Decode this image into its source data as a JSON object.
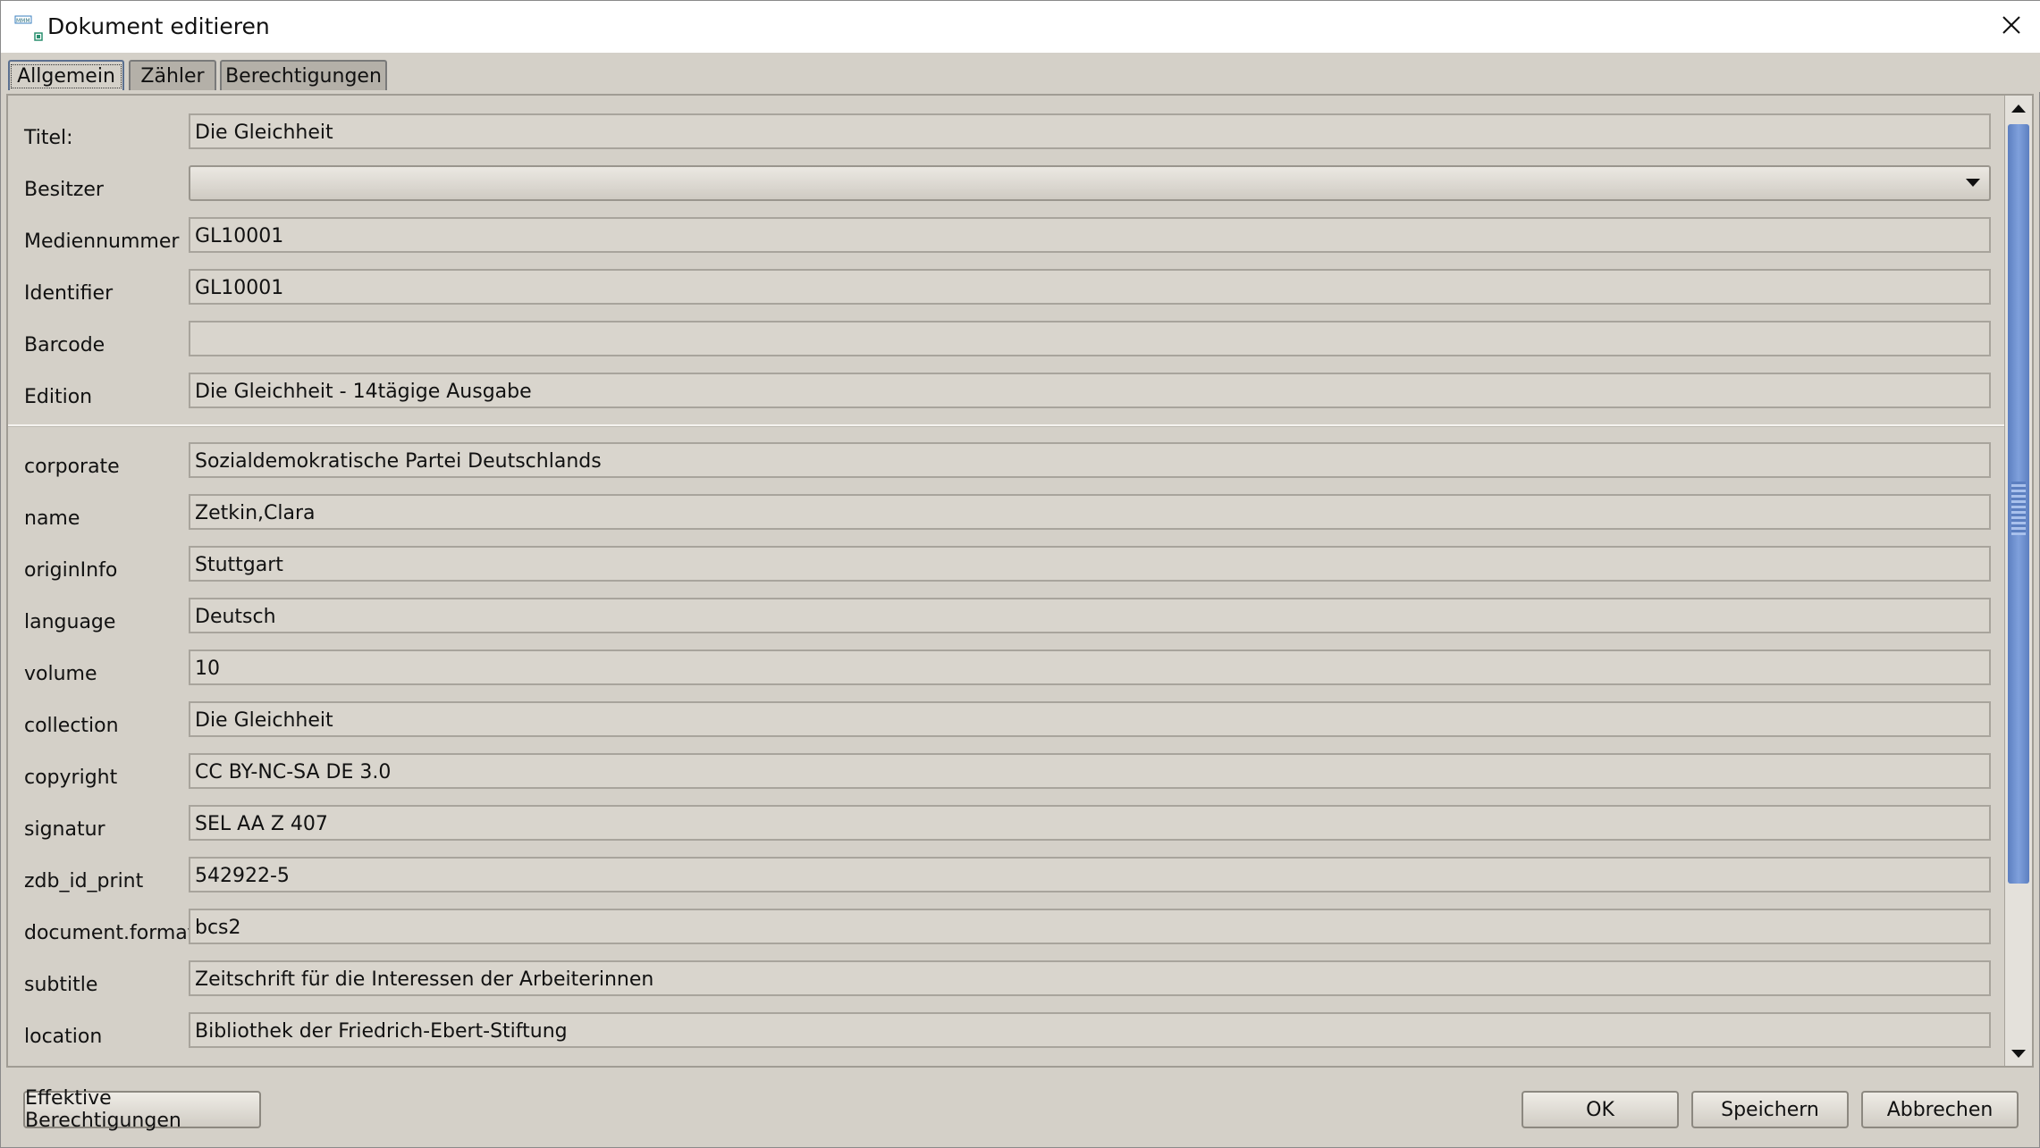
{
  "window": {
    "title": "Dokument editieren",
    "app_icon": "document-app-icon",
    "close_icon": "close-icon"
  },
  "tabs": [
    {
      "label": "Allgemein",
      "active": true
    },
    {
      "label": "Zähler",
      "active": false
    },
    {
      "label": "Berechtigungen",
      "active": false
    }
  ],
  "fields": [
    {
      "label": "Titel:",
      "value": "Die Gleichheit"
    },
    {
      "label": "Besitzer",
      "value": "",
      "type": "select"
    },
    {
      "label": "Mediennummer",
      "value": "GL10001"
    },
    {
      "label": "Identifier",
      "value": "GL10001"
    },
    {
      "label": "Barcode",
      "value": ""
    },
    {
      "label": "Edition",
      "value": "Die Gleichheit - 14tägige Ausgabe"
    }
  ],
  "metadata": [
    {
      "label": "corporate",
      "value": "Sozialdemokratische Partei Deutschlands"
    },
    {
      "label": "name",
      "value": "Zetkin,Clara"
    },
    {
      "label": "originInfo",
      "value": "Stuttgart"
    },
    {
      "label": "language",
      "value": "Deutsch"
    },
    {
      "label": "volume",
      "value": "10"
    },
    {
      "label": "collection",
      "value": "Die Gleichheit"
    },
    {
      "label": "copyright",
      "value": "CC BY-NC-SA DE 3.0"
    },
    {
      "label": "signatur",
      "value": "SEL AA Z 407"
    },
    {
      "label": "zdb_id_print",
      "value": "542922-5"
    },
    {
      "label": "document.format",
      "value": "bcs2"
    },
    {
      "label": "subtitle",
      "value": "Zeitschrift für die Interessen der Arbeiterinnen"
    },
    {
      "label": "location",
      "value": "Bibliothek der Friedrich-Ebert-Stiftung"
    }
  ],
  "buttons": {
    "effective_permissions": "Effektive Berechtigungen",
    "ok": "OK",
    "save": "Speichern",
    "cancel": "Abbrechen"
  },
  "colors": {
    "background": "#d4d0c8",
    "scrollbar_thumb": "#6f8fcf",
    "active_tab_border": "#5a6f8f"
  }
}
